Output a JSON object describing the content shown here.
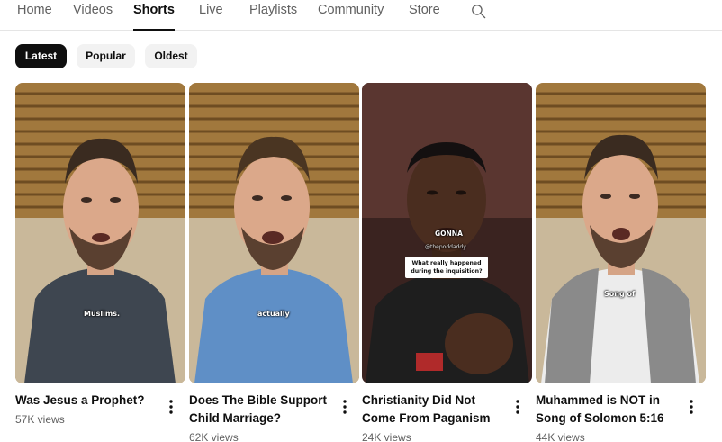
{
  "tabs": [
    {
      "label": "Home"
    },
    {
      "label": "Videos"
    },
    {
      "label": "Shorts"
    },
    {
      "label": "Live"
    },
    {
      "label": "Playlists"
    },
    {
      "label": "Community"
    },
    {
      "label": "Store"
    }
  ],
  "active_tab": "Shorts",
  "search_icon": "search-icon",
  "filters": [
    {
      "label": "Latest"
    },
    {
      "label": "Popular"
    },
    {
      "label": "Oldest"
    }
  ],
  "active_filter": "Latest",
  "shorts": [
    {
      "title": "Was Jesus a Prophet?",
      "views": "57K views",
      "caption": "Muslims."
    },
    {
      "title": "Does The Bible Support Child Marriage?",
      "views": "62K views",
      "caption": "actually"
    },
    {
      "title": "Christianity Did Not Come From Paganism",
      "views": "24K views",
      "caption": "GONNA",
      "handle": "@thepoddaddy",
      "question": "What really happened during the inquisition?"
    },
    {
      "title": "Muhammed is NOT in Song of Solomon 5:16",
      "views": "44K views",
      "caption": "Song of"
    }
  ],
  "colors": {
    "text_primary": "#0f0f0f",
    "text_secondary": "#606060",
    "chip_bg": "#f2f2f2",
    "chip_active_bg": "#0f0f0f"
  }
}
